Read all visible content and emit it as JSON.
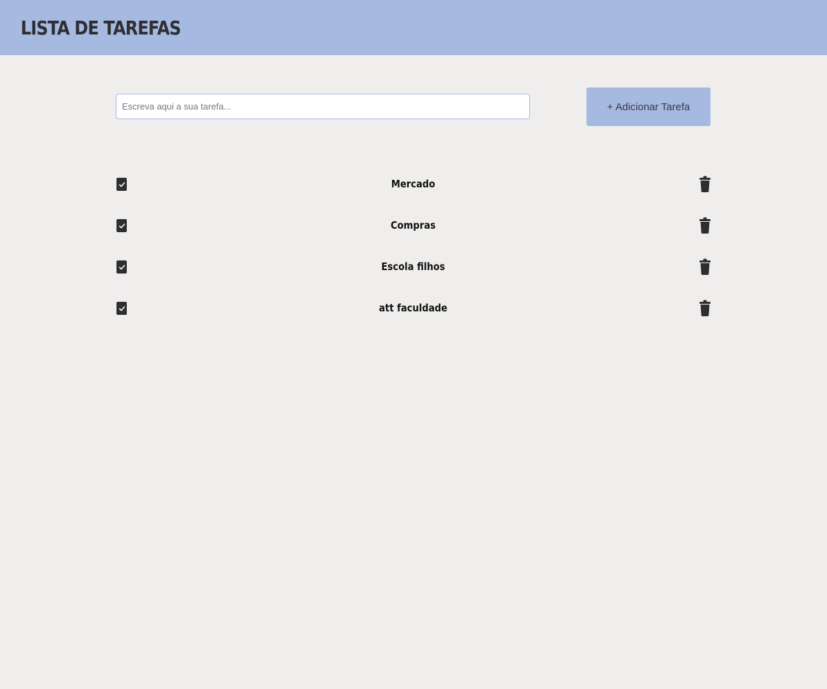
{
  "header": {
    "title": "LISTA DE TAREFAS",
    "background_color": "#a6b9e1"
  },
  "add_form": {
    "input_value": "",
    "input_placeholder": "Escreva aqui a sua tarefa...",
    "add_button_label": "+ Adicionar Tarefa"
  },
  "tasks": [
    {
      "label": "Mercado",
      "checked": true,
      "checkbox_icon": "check-icon",
      "delete_icon": "trash-icon"
    },
    {
      "label": "Compras",
      "checked": true,
      "checkbox_icon": "check-icon",
      "delete_icon": "trash-icon"
    },
    {
      "label": "Escola filhos",
      "checked": true,
      "checkbox_icon": "check-icon",
      "delete_icon": "trash-icon"
    },
    {
      "label": "att faculdade",
      "checked": true,
      "checkbox_icon": "check-icon",
      "delete_icon": "trash-icon"
    }
  ],
  "colors": {
    "page_background": "#f0eeec",
    "accent": "#a6b9e1",
    "icon_dark": "#2e2e30"
  }
}
